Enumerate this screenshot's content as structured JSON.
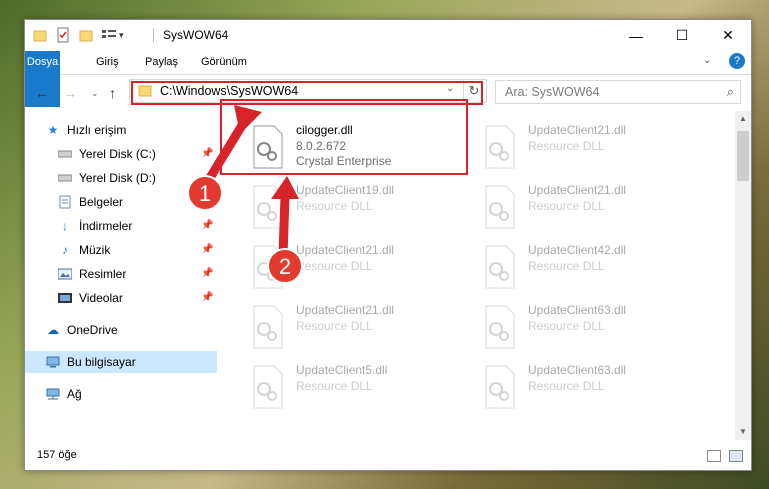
{
  "window": {
    "title": "SysWOW64",
    "minimize": "—",
    "maximize": "☐",
    "close": "✕"
  },
  "ribbon": {
    "tabs": [
      "Dosya",
      "Giriş",
      "Paylaş",
      "Görünüm"
    ],
    "help": "?"
  },
  "nav": {
    "address": "C:\\Windows\\SysWOW64",
    "search_placeholder": "Ara: SysWOW64"
  },
  "sidebar": {
    "items": [
      {
        "label": "Hızlı erişim",
        "icon": "star-icon"
      },
      {
        "label": "Yerel Disk (C:)",
        "icon": "drive-icon"
      },
      {
        "label": "Yerel Disk (D:)",
        "icon": "drive-icon"
      },
      {
        "label": "Belgeler",
        "icon": "documents-icon"
      },
      {
        "label": "İndirmeler",
        "icon": "download-icon"
      },
      {
        "label": "Müzik",
        "icon": "music-icon"
      },
      {
        "label": "Resimler",
        "icon": "pictures-icon"
      },
      {
        "label": "Videolar",
        "icon": "videos-icon"
      },
      {
        "label": "OneDrive",
        "icon": "cloud-icon"
      },
      {
        "label": "Bu bilgisayar",
        "icon": "computer-icon"
      },
      {
        "label": "Ağ",
        "icon": "network-icon"
      }
    ]
  },
  "files": [
    {
      "name": "cilogger.dll",
      "version": "8.0.2.672",
      "company": "Crystal Enterprise"
    },
    {
      "name": "UpdateClient21.dll",
      "type": "Resource DLL"
    },
    {
      "name": "UpdateClient19.dll",
      "type": "Resource DLL"
    },
    {
      "name": "UpdateClient21.dll",
      "type": "Resource DLL"
    },
    {
      "name": "UpdateClient21.dll",
      "type": "Resource DLL"
    },
    {
      "name": "UpdateClient42.dll",
      "type": "Resource DLL"
    },
    {
      "name": "UpdateClient21.dll",
      "type": "Resource DLL"
    },
    {
      "name": "UpdateClient63.dll",
      "type": "Resource DLL"
    },
    {
      "name": "UpdateClient5.dll",
      "type": "Resource DLL"
    },
    {
      "name": "UpdateClient63.dll",
      "type": "Resource DLL"
    }
  ],
  "status": {
    "count": "157 öğe"
  },
  "annotations": {
    "step1": "1",
    "step2": "2"
  },
  "colors": {
    "accent": "#1979ca",
    "highlight": "#d9232a",
    "selected": "#cce8ff"
  }
}
